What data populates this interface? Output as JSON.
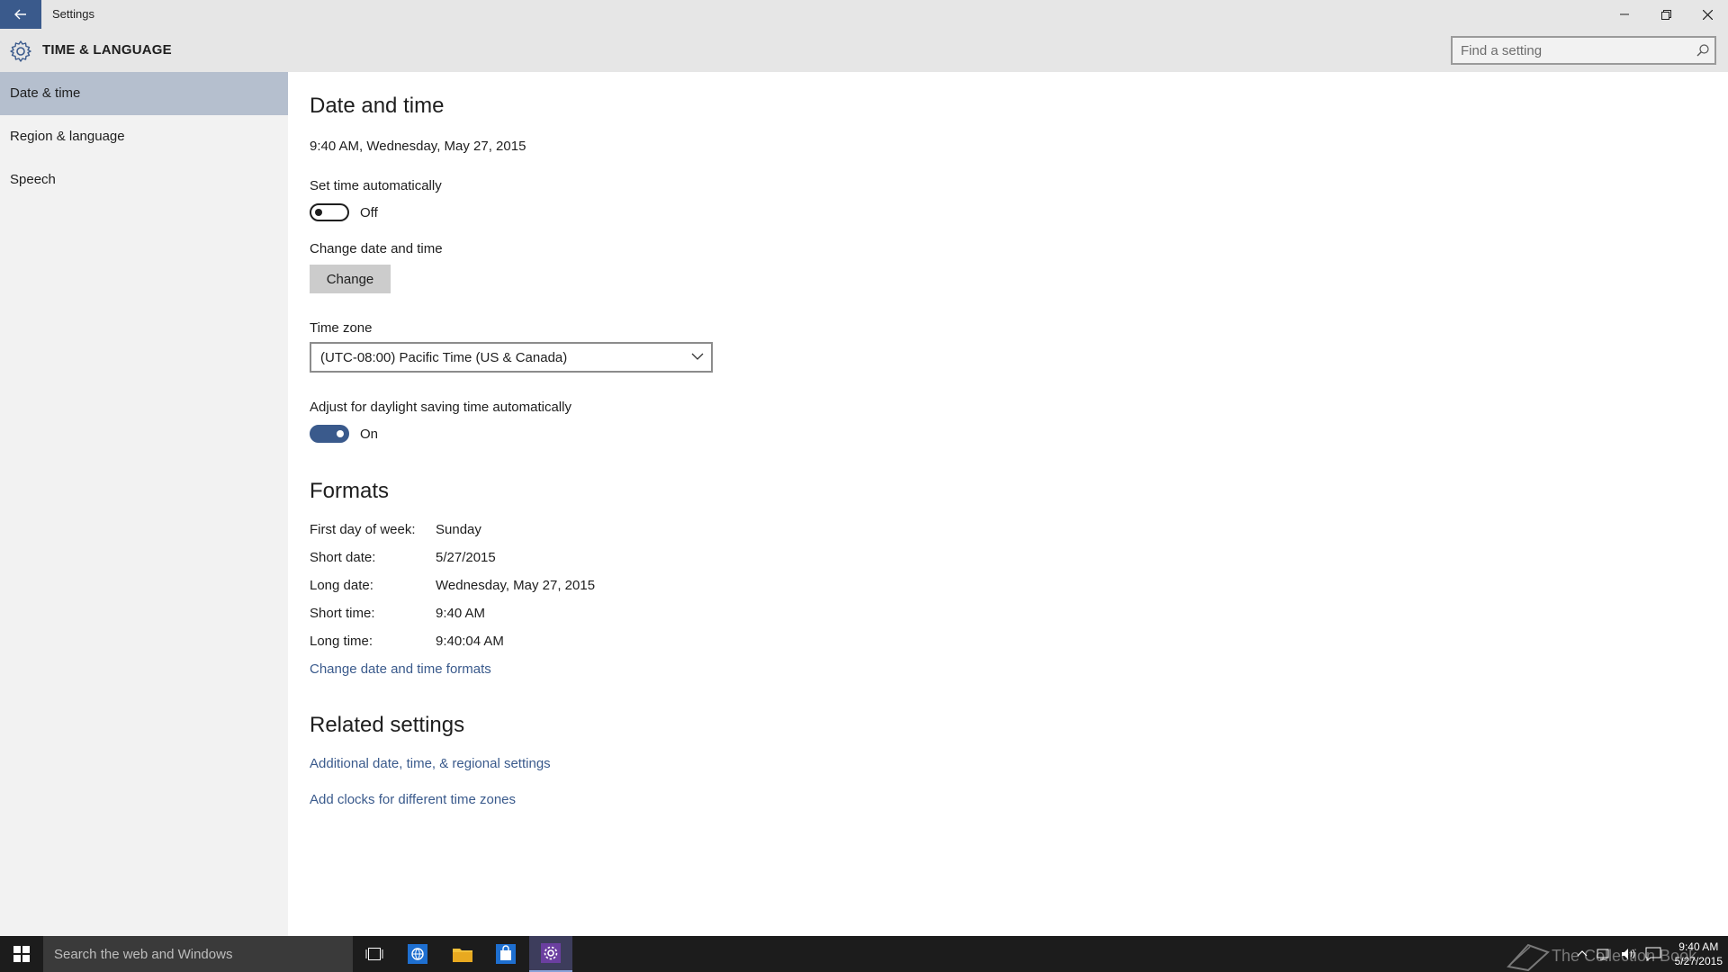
{
  "window": {
    "title": "Settings",
    "controls": [
      "minimize",
      "restore",
      "close"
    ]
  },
  "header": {
    "section_title": "TIME & LANGUAGE",
    "search_placeholder": "Find a setting"
  },
  "sidebar": {
    "items": [
      {
        "label": "Date & time",
        "active": true
      },
      {
        "label": "Region & language",
        "active": false
      },
      {
        "label": "Speech",
        "active": false
      }
    ]
  },
  "main": {
    "heading": "Date and time",
    "current_datetime": "9:40 AM, Wednesday, May 27, 2015",
    "auto_time": {
      "label": "Set time automatically",
      "state": "Off"
    },
    "change": {
      "label": "Change date and time",
      "button": "Change"
    },
    "timezone": {
      "label": "Time zone",
      "value": "(UTC-08:00) Pacific Time (US & Canada)"
    },
    "dst": {
      "label": "Adjust for daylight saving time automatically",
      "state": "On"
    }
  },
  "formats": {
    "heading": "Formats",
    "rows": [
      {
        "key": "First day of week:",
        "value": "Sunday"
      },
      {
        "key": "Short date:",
        "value": "5/27/2015"
      },
      {
        "key": "Long date:",
        "value": "Wednesday, May 27, 2015"
      },
      {
        "key": "Short time:",
        "value": "9:40 AM"
      },
      {
        "key": "Long time:",
        "value": "9:40:04 AM"
      }
    ],
    "change_link": "Change date and time formats"
  },
  "related": {
    "heading": "Related settings",
    "links": [
      "Additional date, time, & regional settings",
      "Add clocks for different time zones"
    ]
  },
  "taskbar": {
    "search_text": "Search the web and Windows",
    "clock_time": "9:40 AM",
    "clock_date": "5/27/2015",
    "watermark": "The Collection Book"
  },
  "colors": {
    "accent": "#3a5a8c",
    "sidebar_active": "#b5bfce",
    "chrome": "#e6e6e6",
    "taskbar": "#1c1c1c"
  }
}
